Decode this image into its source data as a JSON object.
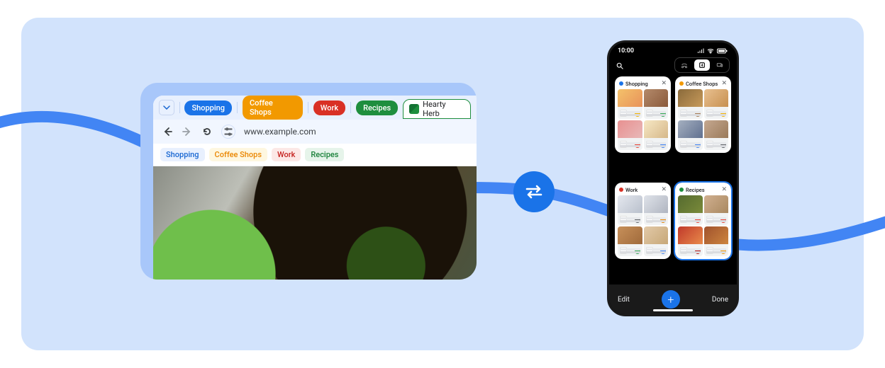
{
  "desktop": {
    "url": "www.example.com",
    "chevron_label": "expand",
    "tabs": [
      {
        "label": "Shopping",
        "color": "blue"
      },
      {
        "label": "Coffee Shops",
        "color": "orange"
      },
      {
        "label": "Work",
        "color": "red"
      },
      {
        "label": "Recipes",
        "color": "green"
      }
    ],
    "active_tab": {
      "label": "Hearty Herb"
    },
    "bookmarks": [
      {
        "label": "Shopping",
        "color": "blue"
      },
      {
        "label": "Coffee Shops",
        "color": "orange"
      },
      {
        "label": "Work",
        "color": "red"
      },
      {
        "label": "Recipes",
        "color": "green"
      }
    ]
  },
  "sync": {
    "icon_name": "sync-swap"
  },
  "phone": {
    "status_time": "10:00",
    "footer": {
      "edit": "Edit",
      "done": "Done",
      "add": "+"
    },
    "groups": [
      {
        "label": "Shopping",
        "dot": "blue",
        "selected": false
      },
      {
        "label": "Coffee Shops",
        "dot": "orange",
        "selected": false
      },
      {
        "label": "Work",
        "dot": "red",
        "selected": false
      },
      {
        "label": "Recipes",
        "dot": "green",
        "selected": true
      }
    ]
  },
  "colors": {
    "accent": "#1a73e8",
    "panel": "#d2e3fc"
  }
}
